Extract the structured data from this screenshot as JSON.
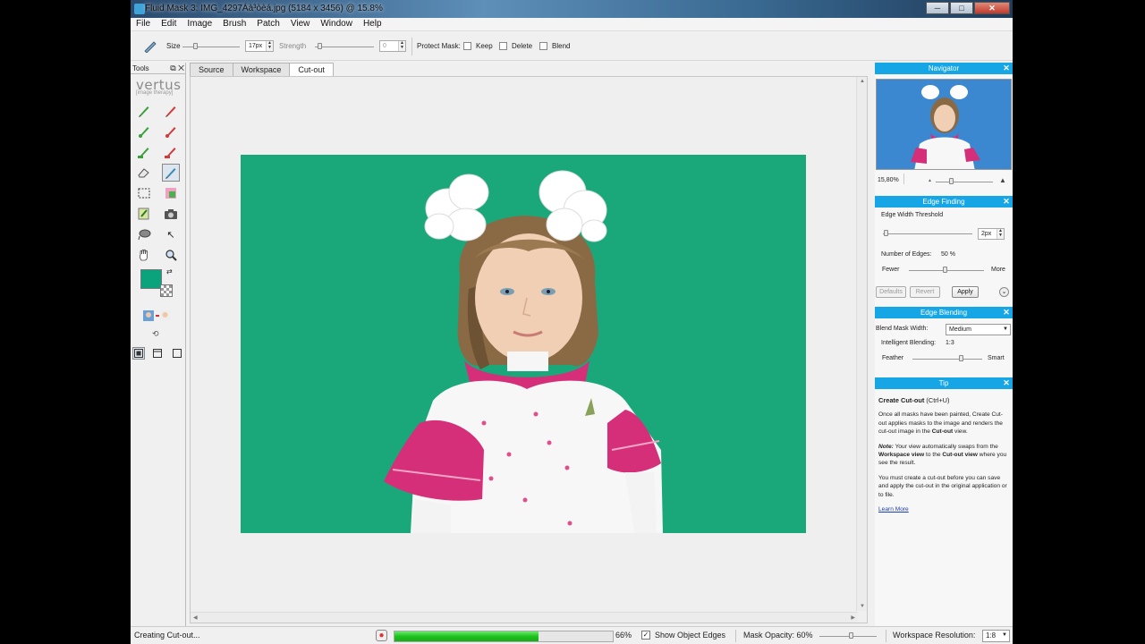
{
  "window": {
    "title": "Fluid Mask 3: IMG_4297Áà³òèá.jpg (5184 x 3456) @ 15.8%",
    "minimize": "─",
    "maximize": "□",
    "close": "✕"
  },
  "menu": [
    "File",
    "Edit",
    "Image",
    "Brush",
    "Patch",
    "View",
    "Window",
    "Help"
  ],
  "toolbar": {
    "size_label": "Size",
    "size_value": "17px",
    "strength_label": "Strength",
    "strength_value": "0",
    "protect_mask_label": "Protect Mask:",
    "keep_label": "Keep",
    "delete_label": "Delete",
    "blend_label": "Blend",
    "spin_up": "▲",
    "spin_down": "▼"
  },
  "tools_panel": {
    "title": "Tools",
    "header_icons": "⧉ ✕",
    "brand": "vertus",
    "brand_sub": "[image therapy]",
    "icons": {
      "brush_green": "✎",
      "brush_red": "✎",
      "eraser": "⌫",
      "pointer": "↖",
      "hand": "✋",
      "zoom": "🔍",
      "camera": "📷",
      "swap": "⇄",
      "reset": "⟲"
    }
  },
  "tabs": [
    "Source",
    "Workspace",
    "Cut-out"
  ],
  "active_tab": "Cut-out",
  "navigator": {
    "title": "Navigator",
    "zoom": "15,80%",
    "zoom_out": "▲",
    "zoom_in": "▲"
  },
  "edge_finding": {
    "title": "Edge Finding",
    "threshold_label": "Edge Width Threshold",
    "threshold_value": "2px",
    "num_edges_label": "Number of Edges:",
    "num_edges_value": "50 %",
    "fewer_label": "Fewer",
    "more_label": "More",
    "defaults_label": "Defaults",
    "revert_label": "Revert",
    "apply_label": "Apply",
    "expand_glyph": "⌄"
  },
  "edge_blending": {
    "title": "Edge Blending",
    "blend_mask_label": "Blend Mask Width:",
    "blend_mask_value": "Medium",
    "intelligent_label": "Intelligent Blending:",
    "intelligent_value": "1:3",
    "feather_label": "Feather",
    "smart_label": "Smart",
    "dd_arrow": "▼"
  },
  "tip": {
    "title": "Tip",
    "heading": "Create Cut-out",
    "shortcut": "(Ctrl+U)",
    "p1_a": "Once all masks have been painted, Create Cut-out applies masks to the image and renders the cut-out image in the ",
    "p1_b": "Cut-out",
    "p1_c": " view.",
    "note_label": "Note:",
    "p2_a": " Your view automatically swaps from the ",
    "p2_b": "Workspace view",
    "p2_c": " to the ",
    "p2_d": "Cut-out view",
    "p2_e": " where you see the result.",
    "p3": "You must create a cut-out before you can save and apply the cut-out in the original application or to file.",
    "learn_more": "Learn More"
  },
  "status": {
    "text": "Creating Cut-out...",
    "progress_percent": 66,
    "progress_label": "66%",
    "show_edges_label": "Show Object Edges",
    "show_edges_checked": true,
    "mask_opacity_label": "Mask Opacity: 60%",
    "workspace_res_label": "Workspace Resolution:",
    "workspace_res_value": "1:8",
    "check_glyph": "✓",
    "stop_glyph": "●"
  },
  "colors": {
    "foreground_swatch": "#0aa37b",
    "canvas_bg": "#1aa87b",
    "panel_header": "#16a6e6",
    "progress": "#1ec21e"
  }
}
